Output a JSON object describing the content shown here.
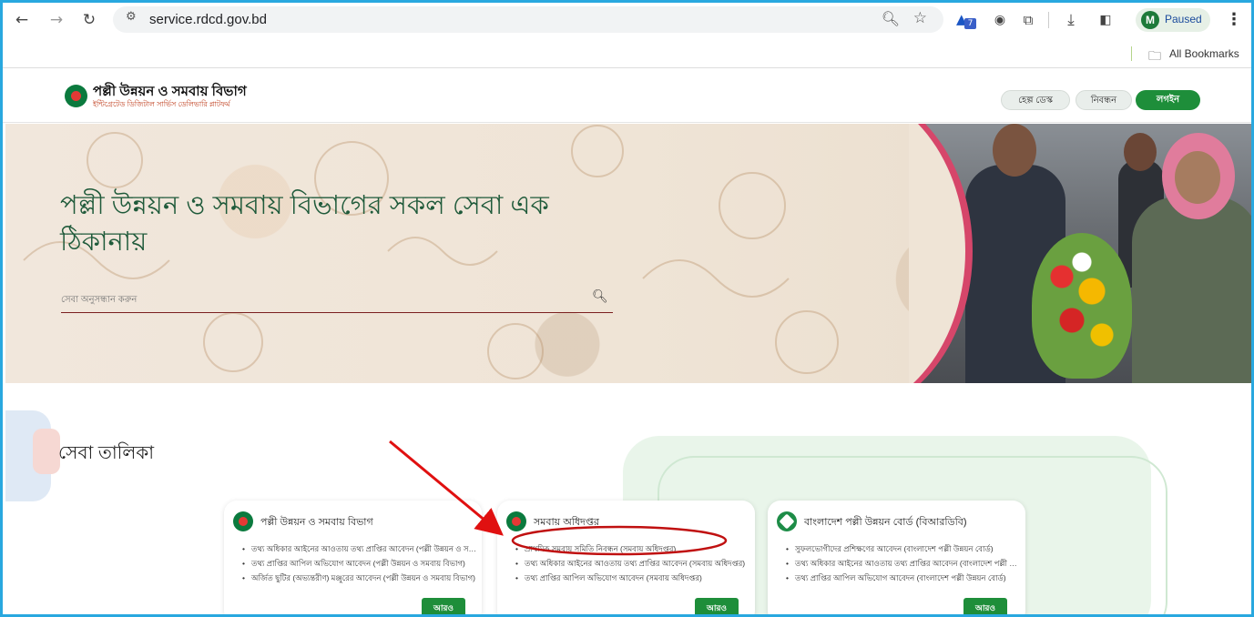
{
  "browser": {
    "url": "service.rdcd.gov.bd",
    "extension_badge": "7",
    "profile_initial": "M",
    "profile_status": "Paused",
    "bookmarks_label": "All Bookmarks"
  },
  "site": {
    "brand_title": "পল্লী উন্নয়ন ও সমবায় বিভাগ",
    "brand_subtitle": "ইন্টিগ্রেটেড ডিজিটাল সার্ভিস ডেলিভারি প্লাটফর্ম",
    "nav": {
      "help_desk": "হেল্প ডেস্ক",
      "register": "নিবন্ধন",
      "login": "লগইন"
    }
  },
  "hero": {
    "title": "পল্লী উন্নয়ন ও সমবায় বিভাগের সকল সেবা এক ঠিকানায়",
    "search_placeholder": "সেবা অনুসন্ধান করুন"
  },
  "services": {
    "title": "সেবা তালিকা",
    "cards": [
      {
        "title": "পল্লী উন্নয়ন ও সমবায় বিভাগ",
        "items": [
          "তথ্য অধিকার আইনের আওতায় তথ্য প্রাপ্তির আবেদন (পল্লী উন্নয়ন ও সমবায় বিভাগ)",
          "তথ্য প্রাপ্তির আপিল অভিযোগ আবেদন (পল্লী উন্নয়ন ও সমবায় বিভাগ)",
          "অর্জিত ছুটির (অভ্যন্তরীণ) মঞ্জুরের আবেদন (পল্লী উন্নয়ন ও সমবায় বিভাগ)"
        ],
        "more": "আরও"
      },
      {
        "title": "সমবায় অধিদপ্তর",
        "items": [
          "প্রাথমিক সমবায় সমিতি নিবন্ধন (সমবায় অধিদপ্তর)",
          "তথ্য অধিকার আইনের আওতায় তথ্য প্রাপ্তির আবেদন (সমবায় অধিদপ্তর)",
          "তথ্য প্রাপ্তির আপিল অভিযোগ আবেদন (সমবায় অধিদপ্তর)"
        ],
        "more": "আরও"
      },
      {
        "title": "বাংলাদেশ পল্লী উন্নয়ন বোর্ড (বিআরডিবি)",
        "items": [
          "সুফলভোগীদের প্রশিক্ষণের আবেদন (বাংলাদেশ পল্লী উন্নয়ন বোর্ড)",
          "তথ্য অধিকার আইনের আওতায় তথ্য প্রাপ্তির আবেদন (বাংলাদেশ পল্লী উন্নয়ন বোর্ড)",
          "তথ্য প্রাপ্তির আপিল অভিযোগ আবেদন (বাংলাদেশ পল্লী উন্নয়ন বোর্ড)"
        ],
        "more": "আরও"
      }
    ]
  },
  "colors": {
    "frame": "#29a8df",
    "brand_green": "#1e8e3a",
    "annotation_red": "#e01010"
  }
}
